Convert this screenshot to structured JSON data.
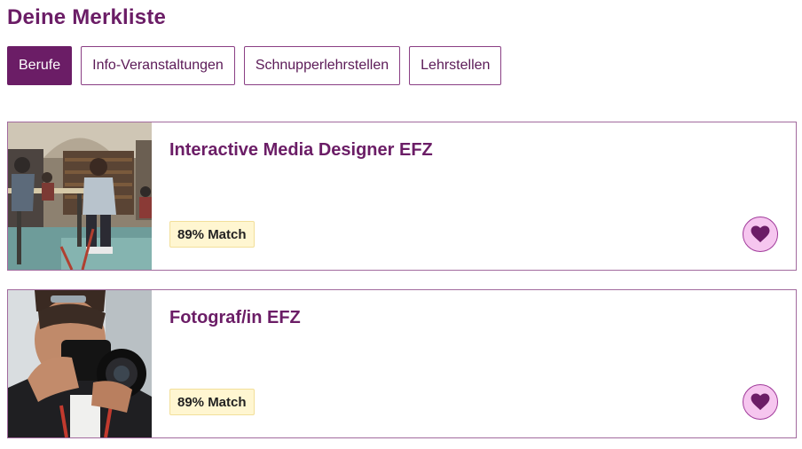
{
  "page": {
    "title": "Deine Merkliste"
  },
  "tabs": [
    {
      "label": "Berufe",
      "active": true
    },
    {
      "label": "Info-Veranstaltungen",
      "active": false
    },
    {
      "label": "Schnupperlehrstellen",
      "active": false
    },
    {
      "label": "Lehrstellen",
      "active": false
    }
  ],
  "cards": [
    {
      "title": "Interactive Media Designer EFZ",
      "match": "89% Match",
      "image": "library-workspace-photo",
      "favorited": true
    },
    {
      "title": "Fotograf/in EFZ",
      "match": "89% Match",
      "image": "photographer-camera-photo",
      "favorited": true
    }
  ],
  "colors": {
    "brand": "#6b1d66",
    "badge_bg": "#fff6d1",
    "heart_bg": "#f6c6ef"
  },
  "icons": {
    "favorite": "heart-icon"
  }
}
